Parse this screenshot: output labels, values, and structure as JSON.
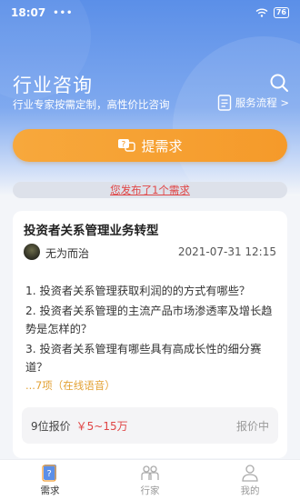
{
  "statusbar": {
    "time": "18:07",
    "dots": "•••",
    "battery": "76"
  },
  "header": {
    "title": "行业咨询",
    "subtitle": "行业专家按需定制，高性价比咨询",
    "process_link": "服务流程 >"
  },
  "actions": {
    "submit_label": "提需求"
  },
  "notice": {
    "text": "您发布了1个需求"
  },
  "card": {
    "title": "投资者关系管理业务转型",
    "author": "无为而治",
    "date": "2021-07-31 12:15",
    "questions": [
      "1. 投资者关系管理获取利润的的方式有哪些？",
      "2. 投资者关系管理的主流产品市场渗透率及增长趋势是怎样的？",
      "3. 投资者关系管理有哪些具有高成长性的细分赛道？"
    ],
    "more": "...7项（在线语音）",
    "quote_count": "9位报价",
    "quote_price": "￥5~15万",
    "quote_status": "报价中"
  },
  "tabbar": {
    "tabs": [
      {
        "label": "需求",
        "icon": "question-doc-icon",
        "active": true
      },
      {
        "label": "行家",
        "icon": "experts-icon",
        "active": false
      },
      {
        "label": "我的",
        "icon": "profile-icon",
        "active": false
      }
    ]
  },
  "colors": {
    "header_blue": "#5b8fe8",
    "accent_orange": "#f59a2a",
    "price_red": "#e04545"
  }
}
